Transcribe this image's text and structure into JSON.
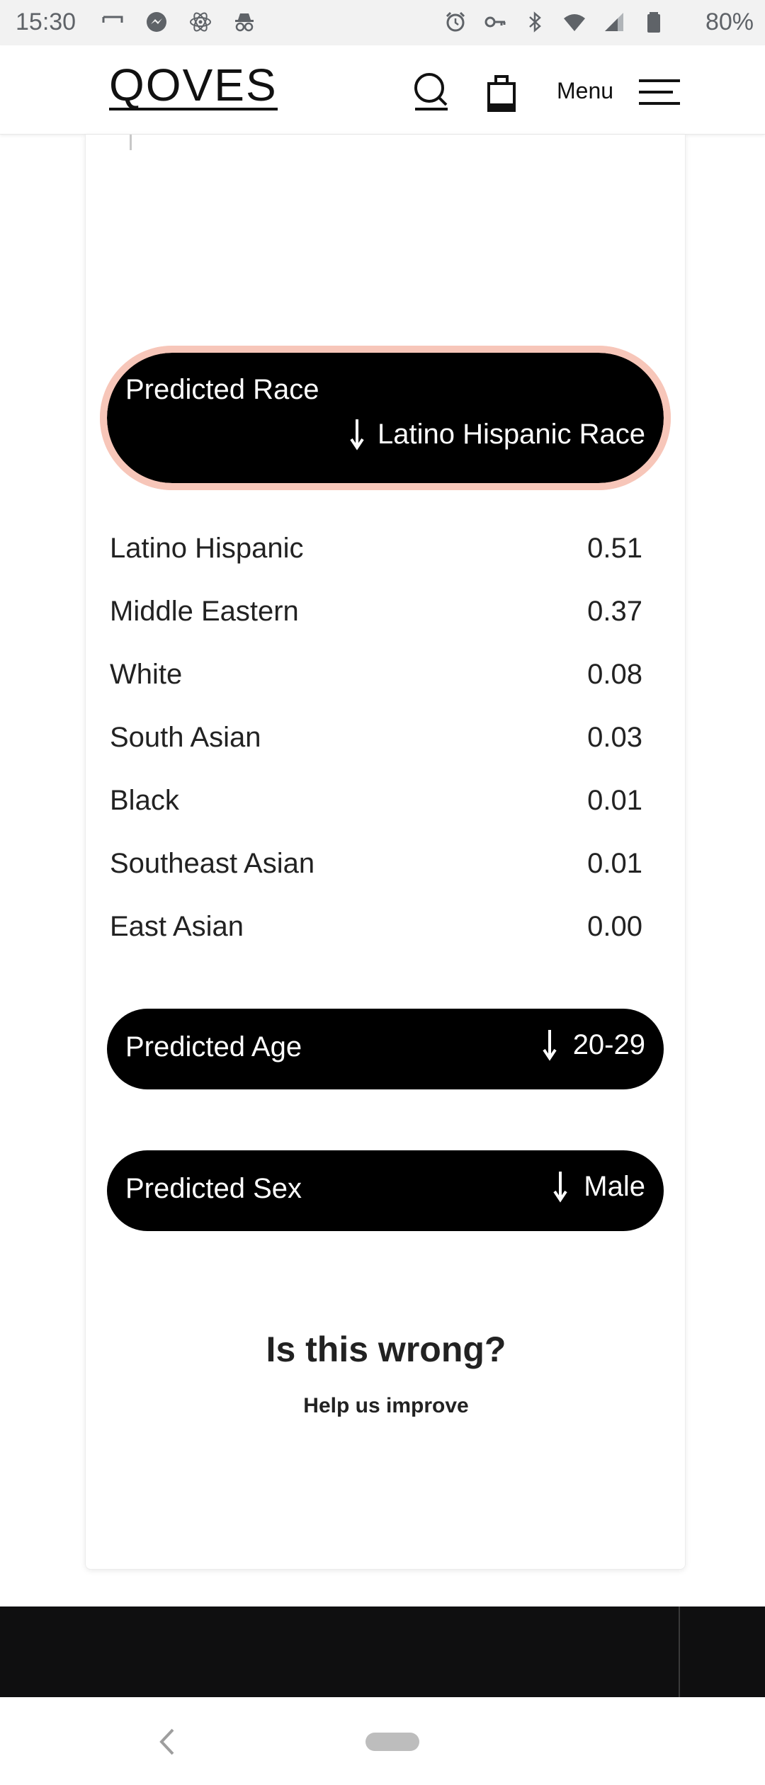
{
  "status_bar": {
    "time": "15:30",
    "battery_percent": "80%",
    "left_icons": [
      "screen-icon",
      "messenger-icon",
      "atom-icon",
      "incognito-icon"
    ],
    "right_icons": [
      "alarm-icon",
      "key-icon",
      "bluetooth-icon",
      "wifi-icon",
      "signal-icon",
      "battery-icon"
    ]
  },
  "header": {
    "logo": "QOVES",
    "menu_label": "Menu"
  },
  "race": {
    "title": "Predicted Race",
    "value": "Latino Hispanic Race",
    "rows": [
      {
        "name": "Latino Hispanic",
        "score": "0.51"
      },
      {
        "name": "Middle Eastern",
        "score": "0.37"
      },
      {
        "name": "White",
        "score": "0.08"
      },
      {
        "name": "South Asian",
        "score": "0.03"
      },
      {
        "name": "Black",
        "score": "0.01"
      },
      {
        "name": "Southeast Asian",
        "score": "0.01"
      },
      {
        "name": "East Asian",
        "score": "0.00"
      }
    ]
  },
  "age": {
    "title": "Predicted Age",
    "value": "20-29"
  },
  "sex": {
    "title": "Predicted Sex",
    "value": "Male"
  },
  "feedback": {
    "title": "Is this wrong?",
    "subtitle": "Help us improve"
  },
  "colors": {
    "pill_background": "#000000",
    "race_pill_outline": "#f9c7b9",
    "footer": "#0f0f10"
  }
}
